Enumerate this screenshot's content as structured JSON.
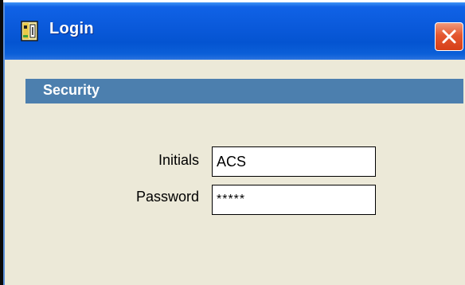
{
  "window": {
    "title": "Login",
    "app_icon": "application-icon",
    "close_icon": "close-icon",
    "close_color": "#d63f18",
    "titlebar_color": "#0a59da"
  },
  "section": {
    "title": "Security",
    "header_color": "#4c7fae"
  },
  "form": {
    "initials_label": "Initials",
    "initials_value": "ACS",
    "password_label": "Password",
    "password_value": "*****"
  }
}
